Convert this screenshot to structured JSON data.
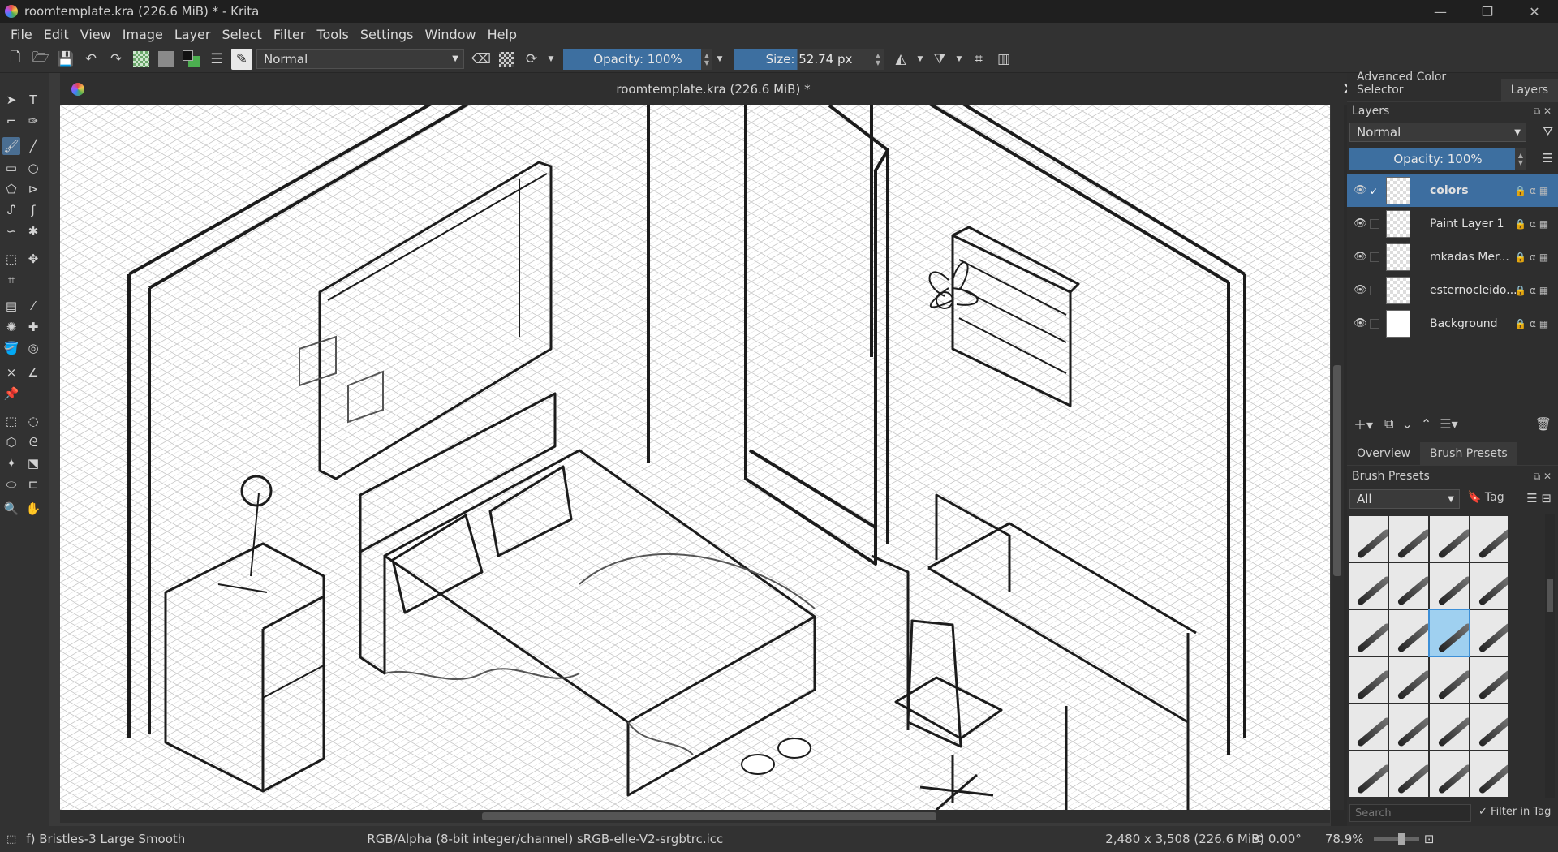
{
  "app": {
    "title": "roomtemplate.kra (226.6 MiB) * - Krita"
  },
  "window_controls": {
    "minimize": "—",
    "maximize": "❐",
    "close": "✕"
  },
  "menu": [
    "File",
    "Edit",
    "View",
    "Image",
    "Layer",
    "Select",
    "Filter",
    "Tools",
    "Settings",
    "Window",
    "Help"
  ],
  "toolbar": {
    "blend_mode": "Normal",
    "opacity_label": "Opacity: 100%",
    "opacity_value": 100,
    "size_label": "Size: 52.74 px",
    "size_value": 52.74
  },
  "document": {
    "tab_title": "roomtemplate.kra (226.6 MiB) *",
    "close_glyph": "✕"
  },
  "dock": {
    "tabs": [
      "Advanced Color Selector",
      "Layers"
    ],
    "active_tab": "Layers",
    "layers_title": "Layers",
    "blend_mode": "Normal",
    "opacity_label": "Opacity:  100%",
    "layers": [
      {
        "name": "colors",
        "active": true,
        "checked": true
      },
      {
        "name": "Paint Layer 1",
        "active": false,
        "checked": false
      },
      {
        "name": "mkadas Mer...",
        "active": false,
        "checked": false
      },
      {
        "name": "esternocleido...",
        "active": false,
        "checked": false
      },
      {
        "name": "Background",
        "active": false,
        "checked": false
      }
    ],
    "bottom_tabs": [
      "Overview",
      "Brush Presets"
    ],
    "bottom_active": "Brush Presets",
    "presets_title": "Brush Presets",
    "filter_all": "All",
    "tag_label": "Tag",
    "search_placeholder": "Search",
    "filter_in_tag": "Filter in Tag"
  },
  "status": {
    "brush": "f) Bristles-3 Large Smooth",
    "color_space": "RGB/Alpha (8-bit integer/channel)  sRGB-elle-V2-srgbtrc.icc",
    "image_size": "2,480 x 3,508 (226.6 MiB)",
    "rotation": "0.00°",
    "zoom": "78.9%"
  },
  "colors": {
    "accent": "#3d6ea0",
    "background": "#2b2b2b",
    "canvas": "#ffffff"
  }
}
